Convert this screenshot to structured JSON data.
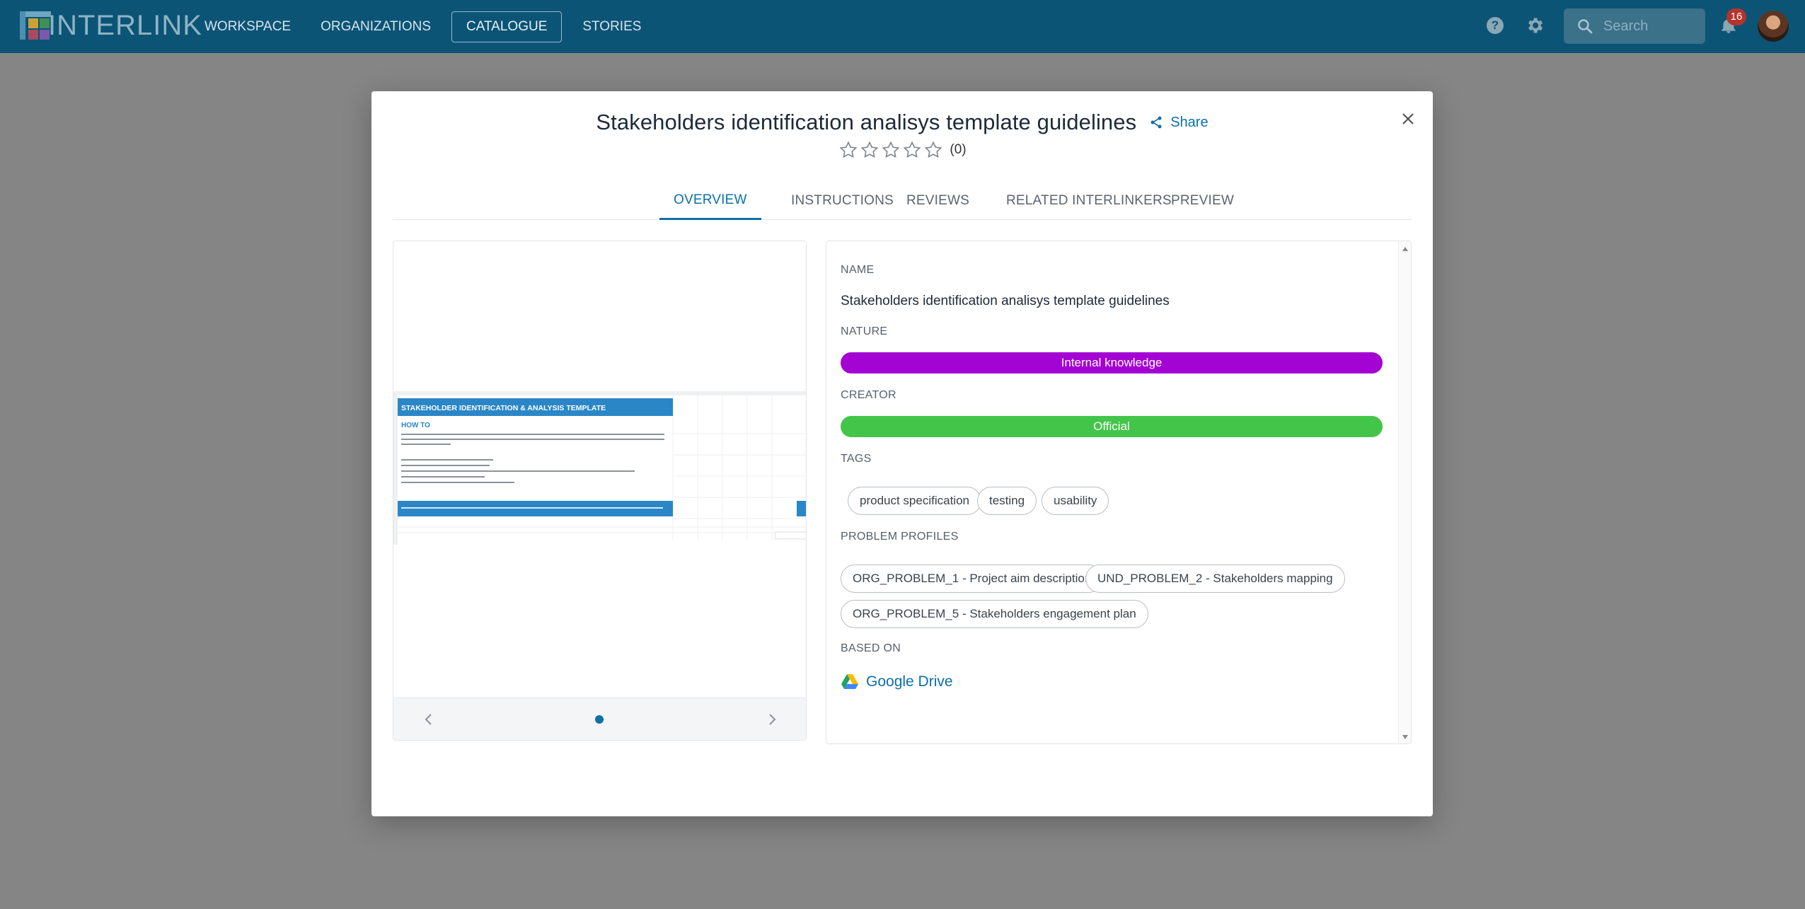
{
  "nav": {
    "logo_text": "INTERLINK",
    "items": [
      {
        "label": "WORKSPACE"
      },
      {
        "label": "ORGANIZATIONS"
      },
      {
        "label": "CATALOGUE"
      },
      {
        "label": "STORIES"
      }
    ],
    "search_placeholder": "Search",
    "notifications_count": "16"
  },
  "modal": {
    "title": "Stakeholders identification analisys template guidelines",
    "share_label": "Share",
    "rating_count": "(0)",
    "tabs": [
      {
        "label": "OVERVIEW"
      },
      {
        "label": "INSTRUCTIONS"
      },
      {
        "label": "REVIEWS"
      },
      {
        "label": "RELATED INTERLINKERS"
      },
      {
        "label": "PREVIEW"
      }
    ],
    "details": {
      "name_label": "NAME",
      "name_value": "Stakeholders identification analisys template guidelines",
      "nature_label": "NATURE",
      "nature_value": "Internal knowledge",
      "creator_label": "CREATOR",
      "creator_value": "Official",
      "tags_label": "TAGS",
      "tags": [
        "product specification",
        "testing",
        "usability"
      ],
      "problem_profiles_label": "PROBLEM PROFILES",
      "problem_profiles": [
        "ORG_PROBLEM_1 - Project aim description",
        "UND_PROBLEM_2 - Stakeholders mapping",
        "ORG_PROBLEM_5 - Stakeholders engagement plan"
      ],
      "based_on_label": "BASED ON",
      "based_on_value": "Google Drive"
    },
    "preview_slide": {
      "heading": "STAKEHOLDER IDENTIFICATION & ANALYSIS TEMPLATE",
      "subheading": "HOW TO"
    }
  },
  "colors": {
    "nav_bg": "#0b5476",
    "accent": "#0b70a8",
    "nature_pill": "#a304d3",
    "creator_pill": "#43c54a",
    "badge": "#b4342c"
  }
}
